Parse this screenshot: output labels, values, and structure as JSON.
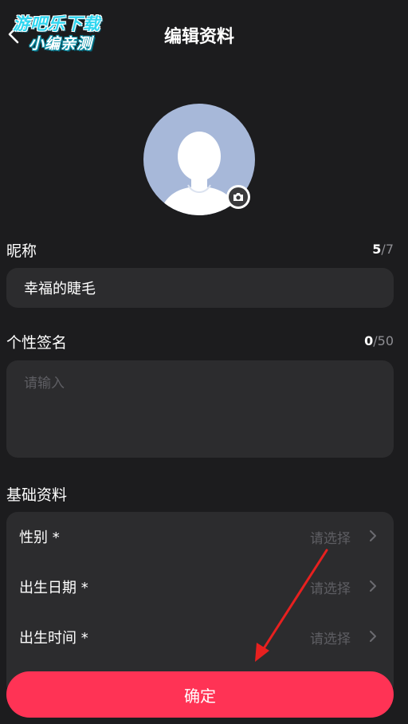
{
  "header": {
    "title": "编辑资料",
    "back_icon": "chevron-left-icon",
    "watermark": {
      "line1": "游吧乐下载",
      "line2": "小编亲测"
    }
  },
  "avatar": {
    "camera_icon": "camera-icon",
    "colors": {
      "bg": "#a7b8d9"
    }
  },
  "nickname": {
    "label": "昵称",
    "count": "5",
    "max": "/7",
    "value": "幸福的睫毛"
  },
  "signature": {
    "label": "个性签名",
    "count": "0",
    "max": "/50",
    "placeholder": "请输入"
  },
  "basic": {
    "label": "基础资料",
    "rows": [
      {
        "label": "性别 *",
        "value": "请选择"
      },
      {
        "label": "出生日期 *",
        "value": "请选择"
      },
      {
        "label": "出生时间 *",
        "value": "请选择"
      }
    ]
  },
  "confirm": {
    "label": "确定"
  },
  "colors": {
    "background": "#1c1c1e",
    "card": "#2c2c2e",
    "accent": "#ff3355",
    "annotation_arrow": "#e8201f"
  }
}
